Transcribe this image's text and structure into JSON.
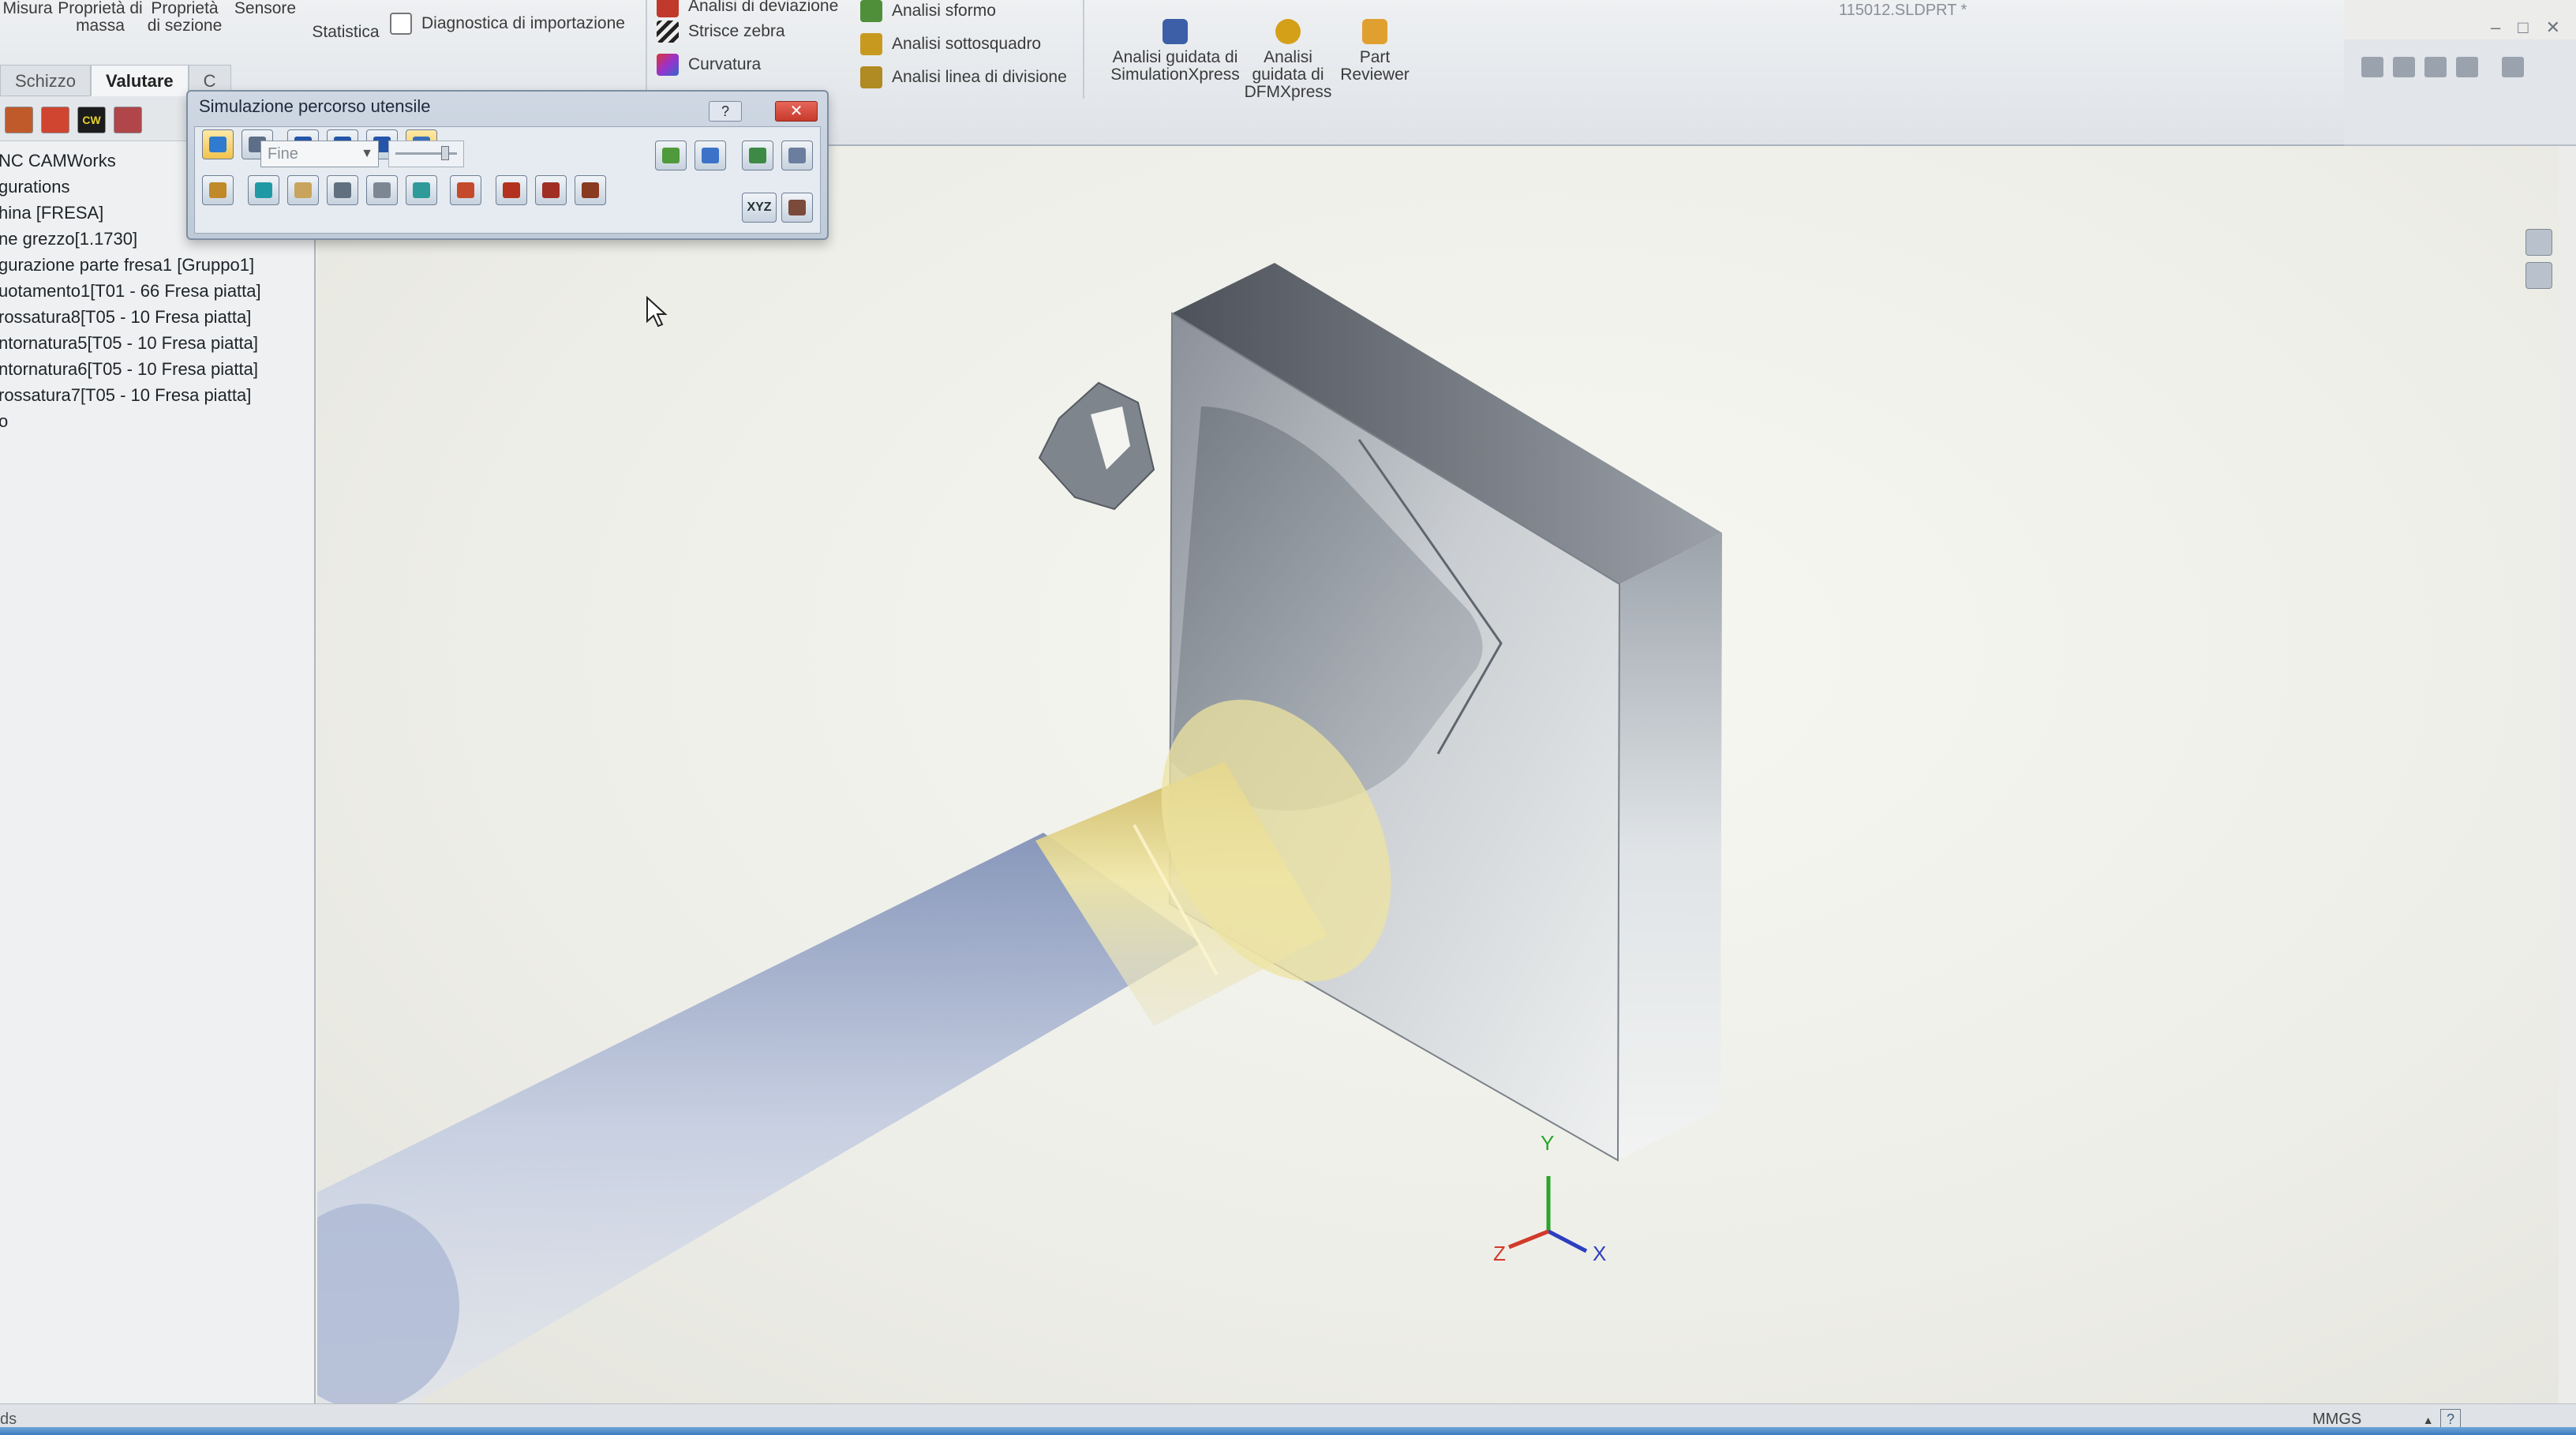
{
  "window": {
    "doc_title": "115012.SLDPRT *",
    "controls": [
      "–",
      "□",
      "✕"
    ]
  },
  "ribbon": {
    "buttons": [
      {
        "label": "Misura",
        "icon": "measure-icon"
      },
      {
        "label": "Proprietà di massa",
        "icon": "mass-properties-icon"
      },
      {
        "label": "Proprietà di sezione",
        "icon": "section-properties-icon"
      },
      {
        "label": "Sensore",
        "icon": "sensor-icon"
      },
      {
        "label": "Statistica",
        "icon": "statistics-icon"
      }
    ],
    "import_diagnostics": "Diagnostica di importazione",
    "analysis_col1": [
      {
        "label": "Analisi di deviazione",
        "icon": "deviation-analysis-icon",
        "color": "#c0392b"
      },
      {
        "label": "Strisce zebra",
        "icon": "zebra-stripes-icon",
        "color": "#333333"
      },
      {
        "label": "Curvatura",
        "icon": "curvature-icon",
        "color": "#7b3fb5"
      }
    ],
    "analysis_col2": [
      {
        "label": "Analisi sformo",
        "icon": "draft-analysis-icon",
        "color": "#4f8f3a"
      },
      {
        "label": "Analisi sottosquadro",
        "icon": "undercut-analysis-icon",
        "color": "#c79a1f"
      },
      {
        "label": "Analisi linea di divisione",
        "icon": "parting-line-icon",
        "color": "#b08a22"
      }
    ],
    "tools": [
      {
        "label": "Analisi guidata di SimulationXpress",
        "icon": "simulationxpress-icon",
        "color": "#3c5fa8"
      },
      {
        "label": "Analisi guidata di DFMXpress",
        "icon": "dfmxpress-icon",
        "color": "#d4a017"
      },
      {
        "label": "Part Reviewer",
        "icon": "part-reviewer-icon",
        "color": "#e0a030"
      }
    ]
  },
  "tabs": [
    {
      "label": "Schizzo",
      "active": false
    },
    {
      "label": "Valutare",
      "active": true
    },
    {
      "label": "C",
      "active": false
    }
  ],
  "tree": {
    "items": [
      "NC CAMWorks",
      "gurations",
      "hina [FRESA]",
      "ne grezzo[1.1730]",
      "gurazione parte fresa1 [Gruppo1]",
      "uotamento1[T01 - 66 Fresa piatta]",
      "rossatura8[T05 - 10 Fresa piatta]",
      "ntornatura5[T05 - 10 Fresa piatta]",
      "ntornatura6[T05 - 10 Fresa piatta]",
      "rossatura7[T05 - 10 Fresa piatta]",
      "o"
    ]
  },
  "dialog": {
    "title": "Simulazione percorso utensile",
    "help_label": "?",
    "close_label": "✕",
    "speed_value": "Fine",
    "slider_level": 0.85,
    "xyz_label": "XYZ"
  },
  "triad": {
    "x": "X",
    "y": "Y",
    "z": "Z"
  },
  "status": {
    "left_text": "ds",
    "units": "MMGS",
    "units_arrow": "▲",
    "help": "?"
  },
  "colors": {
    "ribbon_bg": "#e6e9ed",
    "dialog_bg": "#c7d1de",
    "close_red": "#d04b3c",
    "tool_gold": "#d8c56a",
    "tool_blue": "#8fa2c8"
  }
}
